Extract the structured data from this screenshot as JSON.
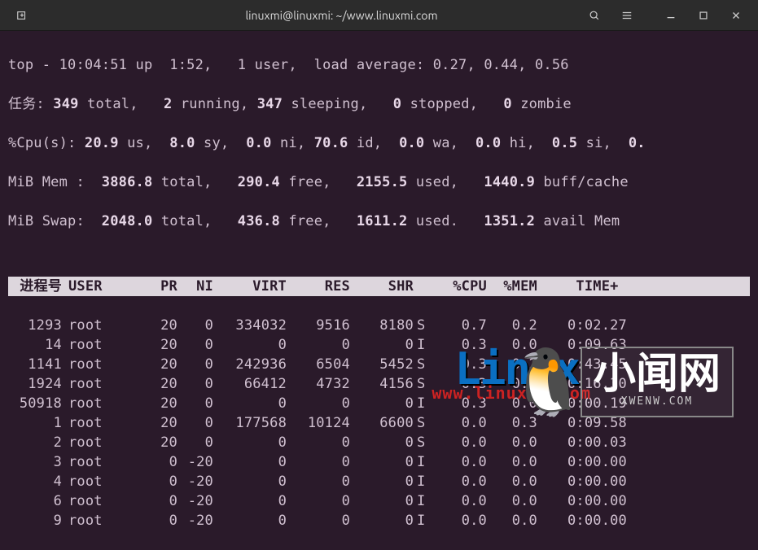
{
  "window": {
    "title": "linuxmi@linuxmi: ~/www.linuxmi.com"
  },
  "summary": {
    "line1_prefix": "top - ",
    "time": "10:04:51",
    "up": " up  1:52,   1 user,  load average: 0.27, 0.44, 0.56",
    "tasks_label": "任务:",
    "tasks_total": "349",
    "tasks_total_lbl": " total,   ",
    "tasks_running": "2",
    "tasks_running_lbl": " running, ",
    "tasks_sleeping": "347",
    "tasks_sleeping_lbl": " sleeping,   ",
    "tasks_stopped": "0",
    "tasks_stopped_lbl": " stopped,   ",
    "tasks_zombie": "0",
    "tasks_zombie_lbl": " zombie",
    "cpu_label": "%Cpu(s): ",
    "cpu_us": "20.9",
    "cpu_us_lbl": " us,  ",
    "cpu_sy": "8.0",
    "cpu_sy_lbl": " sy,  ",
    "cpu_ni": "0.0",
    "cpu_ni_lbl": " ni, ",
    "cpu_id": "70.6",
    "cpu_id_lbl": " id,  ",
    "cpu_wa": "0.0",
    "cpu_wa_lbl": " wa,  ",
    "cpu_hi": "0.0",
    "cpu_hi_lbl": " hi,  ",
    "cpu_si": "0.5",
    "cpu_si_lbl": " si,  ",
    "cpu_st": "0.",
    "mem_label": "MiB Mem :  ",
    "mem_total": "3886.8",
    "mem_total_lbl": " total,   ",
    "mem_free": "290.4",
    "mem_free_lbl": " free,   ",
    "mem_used": "2155.5",
    "mem_used_lbl": " used,   ",
    "mem_buff": "1440.9",
    "mem_buff_lbl": " buff/cache",
    "swap_label": "MiB Swap:  ",
    "swap_total": "2048.0",
    "swap_total_lbl": " total,   ",
    "swap_free": "436.8",
    "swap_free_lbl": " free,   ",
    "swap_used": "1611.2",
    "swap_used_lbl": " used.   ",
    "swap_avail": "1351.2",
    "swap_avail_lbl": " avail Mem"
  },
  "columns": {
    "pid": " 进程号",
    "user": "USER",
    "pr": "PR",
    "ni": "NI",
    "virt": "VIRT",
    "res": "RES",
    "shr": "SHR",
    "s": "",
    "cpu": "%CPU",
    "mem": "%MEM",
    "time": "TIME+ "
  },
  "processes": [
    {
      "pid": "1293",
      "user": "root",
      "pr": "20",
      "ni": "0",
      "virt": "334032",
      "res": "9516",
      "shr": "8180",
      "s": "S",
      "cpu": "0.7",
      "mem": "0.2",
      "time": "0:02.27"
    },
    {
      "pid": "14",
      "user": "root",
      "pr": "20",
      "ni": "0",
      "virt": "0",
      "res": "0",
      "shr": "0",
      "s": "I",
      "cpu": "0.3",
      "mem": "0.0",
      "time": "0:09.63"
    },
    {
      "pid": "1141",
      "user": "root",
      "pr": "20",
      "ni": "0",
      "virt": "242936",
      "res": "6504",
      "shr": "5452",
      "s": "S",
      "cpu": "0.3",
      "mem": "0.2",
      "time": "0:43.45"
    },
    {
      "pid": "1924",
      "user": "root",
      "pr": "20",
      "ni": "0",
      "virt": "66412",
      "res": "4732",
      "shr": "4156",
      "s": "S",
      "cpu": "0.3",
      "mem": "0.1",
      "time": "0:16.30"
    },
    {
      "pid": "50918",
      "user": "root",
      "pr": "20",
      "ni": "0",
      "virt": "0",
      "res": "0",
      "shr": "0",
      "s": "I",
      "cpu": "0.3",
      "mem": "0.0",
      "time": "0:00.19"
    },
    {
      "pid": "1",
      "user": "root",
      "pr": "20",
      "ni": "0",
      "virt": "177568",
      "res": "10124",
      "shr": "6600",
      "s": "S",
      "cpu": "0.0",
      "mem": "0.3",
      "time": "0:09.58"
    },
    {
      "pid": "2",
      "user": "root",
      "pr": "20",
      "ni": "0",
      "virt": "0",
      "res": "0",
      "shr": "0",
      "s": "S",
      "cpu": "0.0",
      "mem": "0.0",
      "time": "0:00.03"
    },
    {
      "pid": "3",
      "user": "root",
      "pr": "0",
      "ni": "-20",
      "virt": "0",
      "res": "0",
      "shr": "0",
      "s": "I",
      "cpu": "0.0",
      "mem": "0.0",
      "time": "0:00.00"
    },
    {
      "pid": "4",
      "user": "root",
      "pr": "0",
      "ni": "-20",
      "virt": "0",
      "res": "0",
      "shr": "0",
      "s": "I",
      "cpu": "0.0",
      "mem": "0.0",
      "time": "0:00.00"
    },
    {
      "pid": "6",
      "user": "root",
      "pr": "0",
      "ni": "-20",
      "virt": "0",
      "res": "0",
      "shr": "0",
      "s": "I",
      "cpu": "0.0",
      "mem": "0.0",
      "time": "0:00.00"
    },
    {
      "pid": "9",
      "user": "root",
      "pr": "0",
      "ni": "-20",
      "virt": "0",
      "res": "0",
      "shr": "0",
      "s": "I",
      "cpu": "0.0",
      "mem": "0.0",
      "time": "0:00.00"
    }
  ],
  "watermark": {
    "brand": "Linux",
    "url": "www.linuxmi.com",
    "box_text": "小闻网",
    "box_sub": "XWENW.COM"
  }
}
